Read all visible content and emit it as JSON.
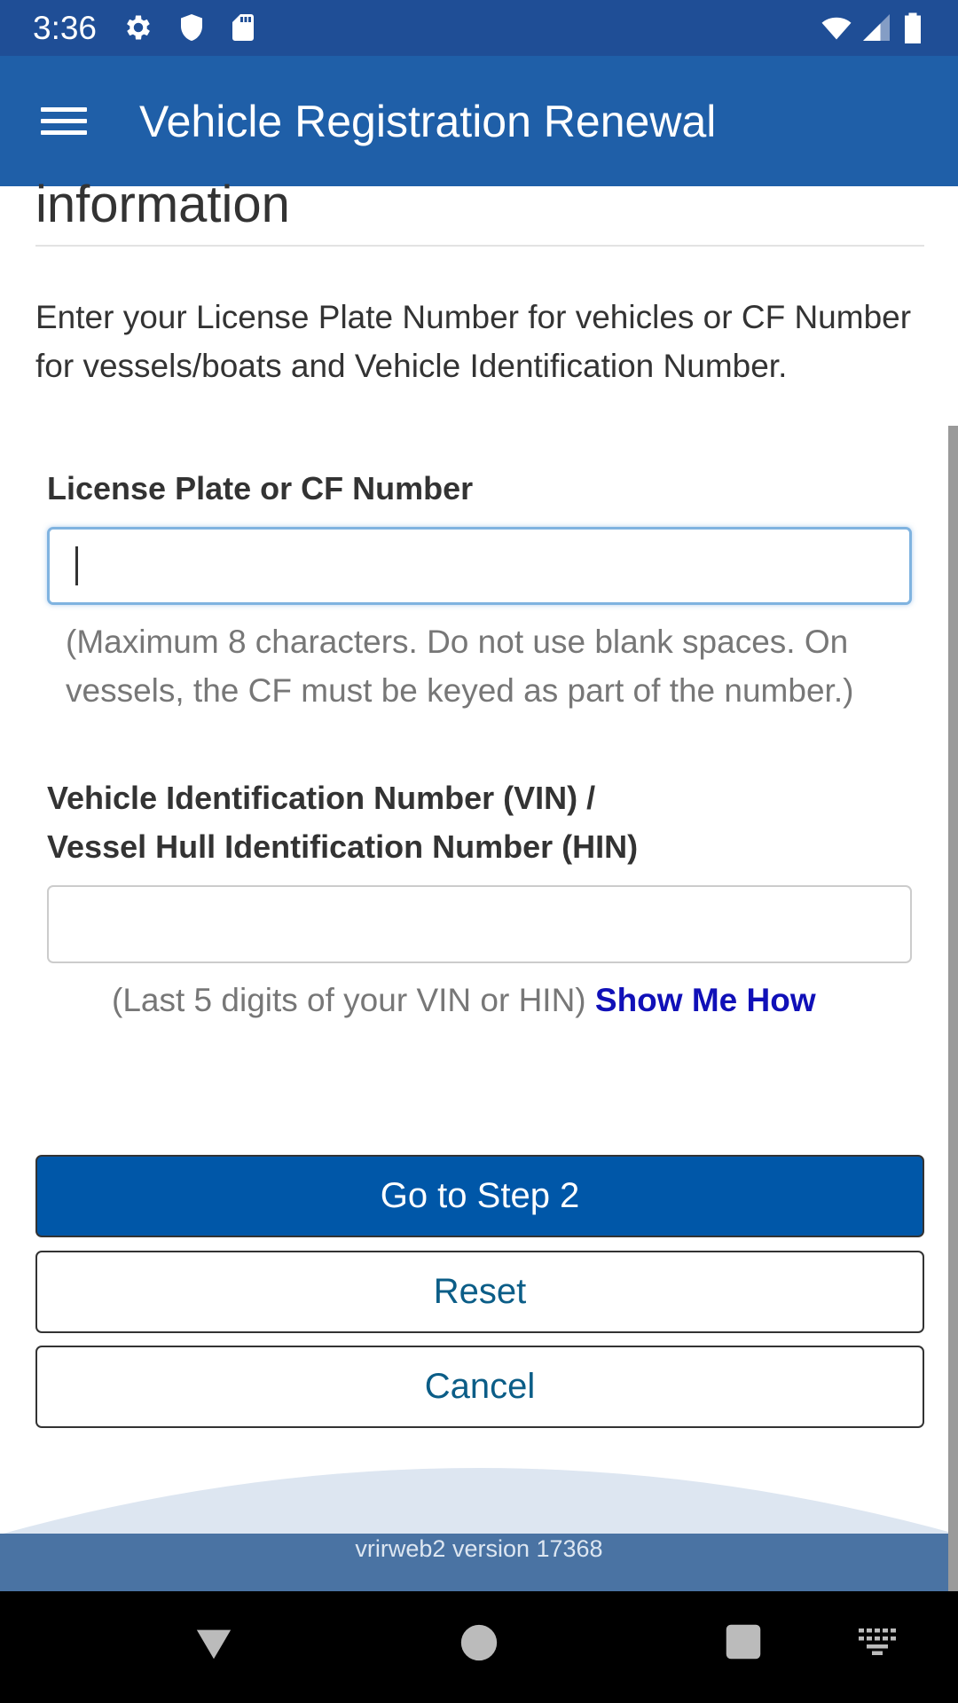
{
  "status_bar": {
    "time": "3:36",
    "icons": [
      "gear-icon",
      "shield-icon",
      "sd-card-icon",
      "wifi-icon",
      "signal-icon",
      "battery-icon"
    ]
  },
  "app_bar": {
    "title": "Vehicle Registration Renewal",
    "menu_icon": "hamburger-menu-icon"
  },
  "content": {
    "section_heading": "information",
    "intro_text": "Enter your License Plate Number for vehicles or CF Number for vessels/boats and Vehicle Identification Number.",
    "plate_field": {
      "label": "License Plate or CF Number",
      "value": "",
      "help": "(Maximum 8 characters. Do not use blank spaces. On vessels, the CF must be keyed as part of the number.)"
    },
    "vin_field": {
      "label_line1": "Vehicle Identification Number (VIN) /",
      "label_line2": "Vessel Hull Identification Number (HIN)",
      "value": "",
      "help": "(Last 5 digits of your VIN or HIN)",
      "help_link": "Show Me How"
    },
    "buttons": {
      "next": "Go to Step 2",
      "reset": "Reset",
      "cancel": "Cancel"
    }
  },
  "footer": {
    "version_text": "vrirweb2 version 17368"
  },
  "nav_bar": {
    "icons": [
      "back-icon",
      "home-icon",
      "recents-icon",
      "keyboard-icon"
    ]
  },
  "colors": {
    "status_bar": "#1f4e96",
    "app_bar": "#1f5fa8",
    "primary_button": "#0057a8",
    "link": "#1010b8",
    "footer": "#4a73a3"
  }
}
